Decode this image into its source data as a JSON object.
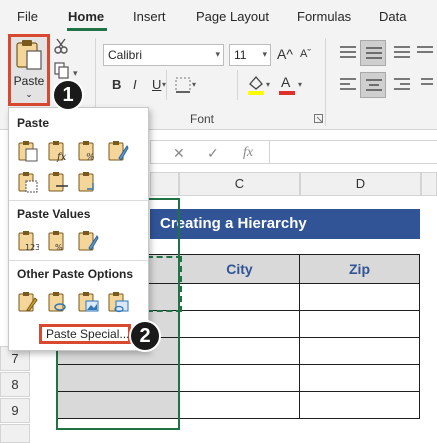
{
  "ribbon": {
    "tabs": [
      {
        "label": "File"
      },
      {
        "label": "Home"
      },
      {
        "label": "Insert"
      },
      {
        "label": "Page Layout"
      },
      {
        "label": "Formulas"
      },
      {
        "label": "Data"
      }
    ],
    "active_tab": "Home",
    "paste_label": "Paste",
    "font_name": "Calibri",
    "font_size": "11",
    "font_group_label": "Font",
    "bold_label": "B",
    "italic_label": "I",
    "underline_label": "U",
    "grow_font": "A^",
    "shrink_font": "Aˇ",
    "font_color_label": "A"
  },
  "formula_bar": {
    "cancel": "✕",
    "enter": "✓",
    "fx": "fx"
  },
  "badges": {
    "one": "1",
    "two": "2"
  },
  "paste_menu": {
    "paste_title": "Paste",
    "paste_values_title": "Paste Values",
    "other_options_title": "Other Paste Options",
    "paste_special_label": "Paste Special..."
  },
  "grid": {
    "columns": [
      "C",
      "D"
    ],
    "rows": [
      "7",
      "8",
      "9"
    ],
    "sheet_title": "Creating a Hierarchy",
    "headers": [
      "City",
      "Zip"
    ]
  },
  "colors": {
    "accent_red": "#d9492f",
    "excel_green": "#217346",
    "title_blue": "#305496",
    "header_gray": "#d9d9d9"
  }
}
